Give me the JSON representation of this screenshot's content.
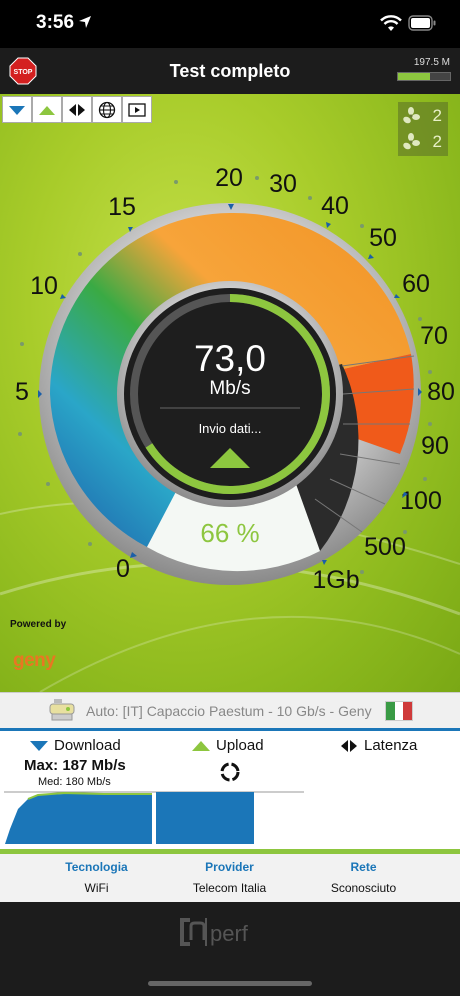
{
  "status": {
    "time": "3:56"
  },
  "header": {
    "title": "Test completo",
    "memory": "197.5 M",
    "memory_fraction": 0.62
  },
  "toolbar": {
    "icons": [
      "download-icon",
      "upload-icon",
      "latency-icon",
      "globe-icon",
      "video-icon"
    ]
  },
  "counters": {
    "row1": "2",
    "row2": "2"
  },
  "gauge": {
    "value": "73,0",
    "unit": "Mb/s",
    "status": "Invio dati...",
    "percent": "66 %",
    "progress": 0.66,
    "scale": [
      "0",
      "5",
      "10",
      "15",
      "20",
      "30",
      "40",
      "50",
      "60",
      "70",
      "80",
      "90",
      "100",
      "500",
      "1Gb"
    ]
  },
  "brand": {
    "powered_by": "Powered by",
    "name": "geny"
  },
  "server": {
    "text": "Auto: [IT] Capaccio Paestum - 10 Gb/s - Geny"
  },
  "results": {
    "download_label": "Download",
    "upload_label": "Upload",
    "latency_label": "Latenza",
    "max": "Max: 187 Mb/s",
    "med": "Med: 180 Mb/s"
  },
  "info": {
    "tech_label": "Tecnologia",
    "tech_value": "WiFi",
    "provider_label": "Provider",
    "provider_value": "Telecom Italia",
    "network_label": "Rete",
    "network_value": "Sconosciuto"
  },
  "footer": {
    "logo": "nperf"
  },
  "colors": {
    "accent": "#8dc63f",
    "blue": "#1b76b8",
    "orange": "#f39a2d"
  }
}
